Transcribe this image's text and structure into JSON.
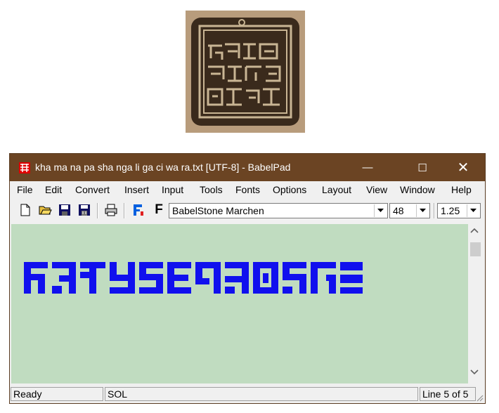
{
  "window": {
    "title": "kha ma na pa sha nga li ga ci wa ra.txt [UTF-8] - BabelPad",
    "controls": {
      "minimize": "—",
      "maximize": "☐",
      "close": "✕"
    }
  },
  "menu": [
    {
      "label": "File"
    },
    {
      "label": "Edit"
    },
    {
      "label": "Convert"
    },
    {
      "label": "Insert"
    },
    {
      "label": "Input"
    },
    {
      "label": "Tools"
    },
    {
      "label": "Fonts"
    },
    {
      "label": "Options"
    },
    {
      "label": "Layout"
    },
    {
      "label": "View"
    },
    {
      "label": "Window"
    },
    {
      "label": "Help"
    }
  ],
  "toolbar": {
    "icons": [
      "new-file-icon",
      "open-folder-icon",
      "save-icon",
      "save-all-icon",
      "print-icon",
      "font-color-icon",
      "font-bold-icon"
    ],
    "font_bold_glyph": "F",
    "font_name": "BabelStone Marchen",
    "font_size": "48",
    "line_spacing": "1.25"
  },
  "editor": {
    "text_color": "#1010ee",
    "background": "#c0dcc0"
  },
  "status": {
    "state": "Ready",
    "position": "SOL",
    "line": "Line 5 of 5"
  },
  "colors": {
    "titlebar": "#6b4423",
    "editor_bg": "#c0dcc0",
    "script_text": "#1010ee"
  }
}
